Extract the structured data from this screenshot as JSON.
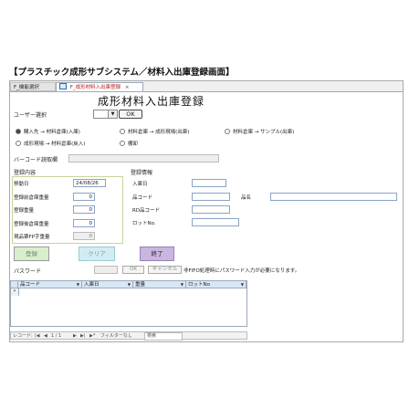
{
  "page_title": "【プラスチック成形サブシステム／材料入出庫登録画面】",
  "tabs": [
    {
      "label": "F_機能選択"
    },
    {
      "label": "F_成形材料入出庫登録",
      "close": "×"
    }
  ],
  "form_title": "成形材料入出庫登録",
  "user_select": {
    "label": "ユーザー選択",
    "value": "",
    "dropdown": "▼",
    "ok_label": "OK"
  },
  "radio_options": [
    {
      "label": "購入先 → 材料倉庫(入庫)",
      "selected": true
    },
    {
      "label": "材料倉庫 → 成形現場(出庫)",
      "selected": false
    },
    {
      "label": "材料倉庫 → サンプル(出庫)",
      "selected": false
    },
    {
      "label": "成形現場 → 材料倉庫(戻入)",
      "selected": false
    },
    {
      "label": "棚卸",
      "selected": false
    }
  ],
  "barcode": {
    "label": "バーコード読取欄",
    "value": ""
  },
  "register_section": {
    "title": "登録内容",
    "rows": [
      {
        "label": "移動日",
        "value": "24/08/26"
      },
      {
        "label": "登録前倉庫重量",
        "value": "0"
      },
      {
        "label": "登録重量",
        "value": "0"
      },
      {
        "label": "登録後倉庫重量",
        "value": "0"
      },
      {
        "label": "現品票FP字重量",
        "value": "0"
      }
    ]
  },
  "info_section": {
    "title": "登録情報",
    "rows": [
      {
        "label": "入庫日",
        "value": ""
      },
      {
        "label": "品コード",
        "value": ""
      },
      {
        "label": "RD品コード",
        "value": ""
      },
      {
        "label": "ロットNo.",
        "value": ""
      }
    ],
    "name_label": "品名",
    "name_value": ""
  },
  "buttons": {
    "register": "登録",
    "clear": "クリア",
    "end": "終了"
  },
  "password": {
    "label": "パスワード",
    "value": "",
    "ok": "OK",
    "cancel": "キャンセル",
    "note": "非FIFO処理時にパスワード入力が必要になります。"
  },
  "table": {
    "columns": [
      "品コード",
      "入庫日",
      "重量",
      "ロットNo"
    ],
    "new_row_marker": "*"
  },
  "nav": {
    "record_label": "レコード:",
    "position": "1 / 1",
    "filter": "フィルターなし",
    "search": "検索"
  }
}
